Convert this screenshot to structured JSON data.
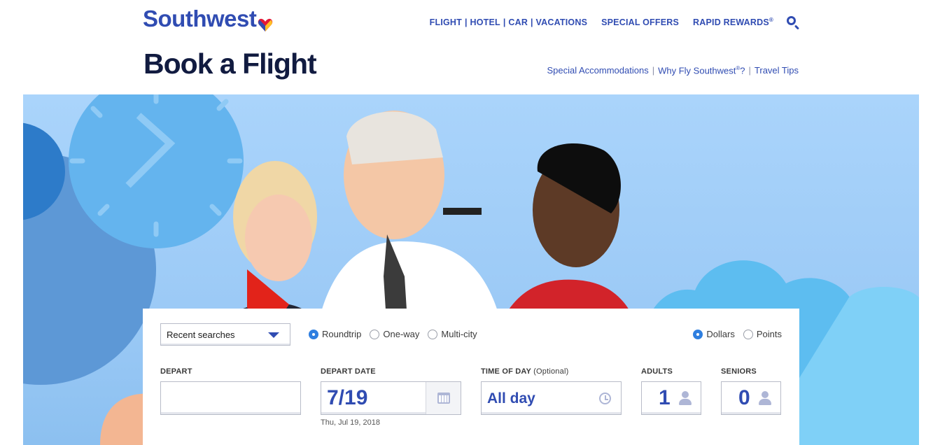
{
  "brand": {
    "name": "Southwest",
    "accent": "#304cb2",
    "title_color": "#111b40"
  },
  "nav": {
    "product_links": [
      "FLIGHT",
      "HOTEL",
      "CAR",
      "VACATIONS"
    ],
    "special_offers": "SPECIAL OFFERS",
    "rapid_rewards": "RAPID REWARDS",
    "rapid_rewards_mark": "®"
  },
  "page_title": "Book a Flight",
  "sub_links": {
    "accommodations": "Special Accommodations",
    "why_fly": "Why Fly Southwest",
    "why_fly_mark": "®",
    "why_fly_suffix": "?",
    "travel_tips": "Travel Tips"
  },
  "booking": {
    "recent_searches": "Recent searches",
    "trip_types": {
      "roundtrip": "Roundtrip",
      "oneway": "One-way",
      "multicity": "Multi-city",
      "selected": "Roundtrip"
    },
    "currency": {
      "dollars": "Dollars",
      "points": "Points",
      "selected": "Dollars"
    },
    "depart": {
      "label": "DEPART",
      "value": ""
    },
    "depart_date": {
      "label": "DEPART DATE",
      "value": "7/19",
      "full": "Thu, Jul 19, 2018"
    },
    "time_of_day": {
      "label": "TIME OF DAY",
      "optional": "(Optional)",
      "value": "All day"
    },
    "adults": {
      "label": "ADULTS",
      "value": "1"
    },
    "seniors": {
      "label": "SENIORS",
      "value": "0"
    }
  },
  "icons": [
    "heart-logo-icon",
    "search-icon",
    "dropdown-caret-icon",
    "calendar-icon",
    "clock-icon",
    "person-icon"
  ]
}
